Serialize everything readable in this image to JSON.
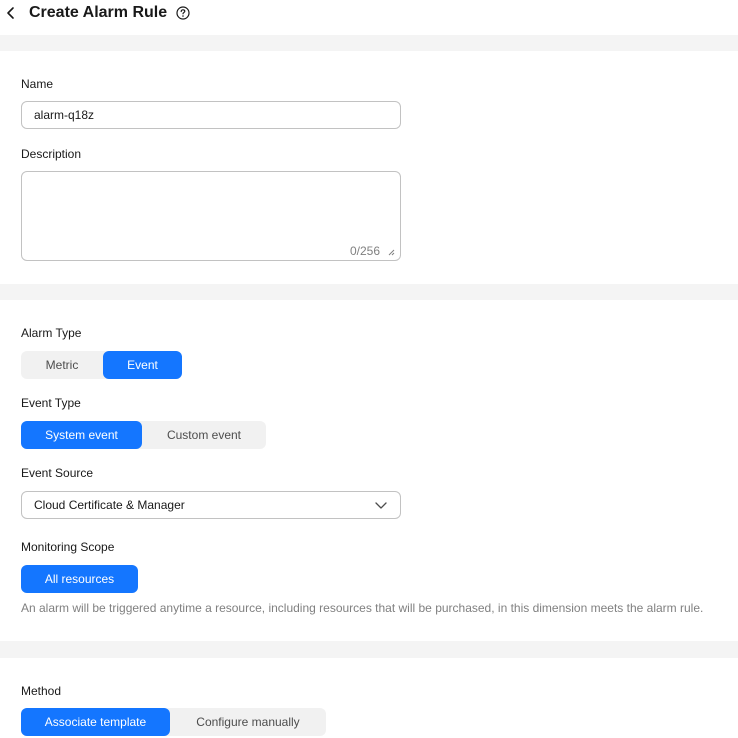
{
  "header": {
    "title": "Create Alarm Rule"
  },
  "basic": {
    "name_label": "Name",
    "name_value": "alarm-q18z",
    "description_label": "Description",
    "description_value": "",
    "description_counter": "0/256"
  },
  "alarm": {
    "alarm_type_label": "Alarm Type",
    "alarm_type_options": [
      "Metric",
      "Event"
    ],
    "alarm_type_selected": "Event",
    "event_type_label": "Event Type",
    "event_type_options": [
      "System event",
      "Custom event"
    ],
    "event_type_selected": "System event",
    "event_source_label": "Event Source",
    "event_source_value": "Cloud Certificate & Manager",
    "monitoring_scope_label": "Monitoring Scope",
    "monitoring_scope_value": "All resources",
    "monitoring_scope_hint": "An alarm will be triggered anytime a resource, including resources that will be purchased, in this dimension meets the alarm rule."
  },
  "method": {
    "label": "Method",
    "options": [
      "Associate template",
      "Configure manually"
    ],
    "selected": "Associate template"
  },
  "icons": {
    "back": "chevron-left-icon",
    "help": "question-circle-icon",
    "resize": "resize-handle-icon",
    "dropdown": "chevron-down-icon"
  },
  "colors": {
    "primary": "#1476ff",
    "page_background": "#f4f4f4",
    "card_background": "#ffffff",
    "border": "#c2c2c2",
    "muted_text": "#808080"
  }
}
